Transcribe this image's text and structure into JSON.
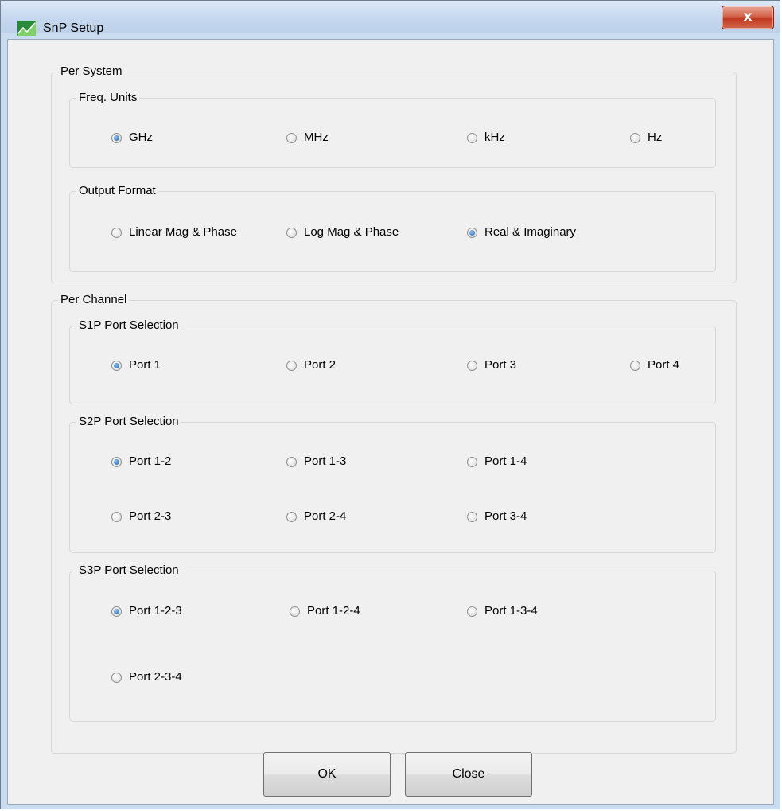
{
  "window": {
    "title": "SnP Setup",
    "close_label": "x"
  },
  "per_system": {
    "label": "Per System",
    "freq_units": {
      "label": "Freq. Units",
      "options": [
        "GHz",
        "MHz",
        "kHz",
        "Hz"
      ],
      "selected": "GHz"
    },
    "output_format": {
      "label": "Output Format",
      "options": [
        "Linear Mag & Phase",
        "Log Mag & Phase",
        "Real & Imaginary"
      ],
      "selected": "Real & Imaginary"
    }
  },
  "per_channel": {
    "label": "Per Channel",
    "s1p": {
      "label": "S1P Port Selection",
      "options": [
        "Port 1",
        "Port 2",
        "Port 3",
        "Port 4"
      ],
      "selected": "Port 1"
    },
    "s2p": {
      "label": "S2P Port Selection",
      "options": [
        "Port 1-2",
        "Port 1-3",
        "Port 1-4",
        "Port 2-3",
        "Port 2-4",
        "Port 3-4"
      ],
      "selected": "Port 1-2"
    },
    "s3p": {
      "label": "S3P Port Selection",
      "options": [
        "Port 1-2-3",
        "Port 1-2-4",
        "Port 1-3-4",
        "Port 2-3-4"
      ],
      "selected": "Port 1-2-3"
    }
  },
  "buttons": {
    "ok": "OK",
    "close": "Close"
  },
  "colors": {
    "title_bar": "#c4d7ee",
    "dialog_bg": "#f0f0f0",
    "close_button": "#c0381f",
    "radio_checked": "#1b5fa8"
  }
}
